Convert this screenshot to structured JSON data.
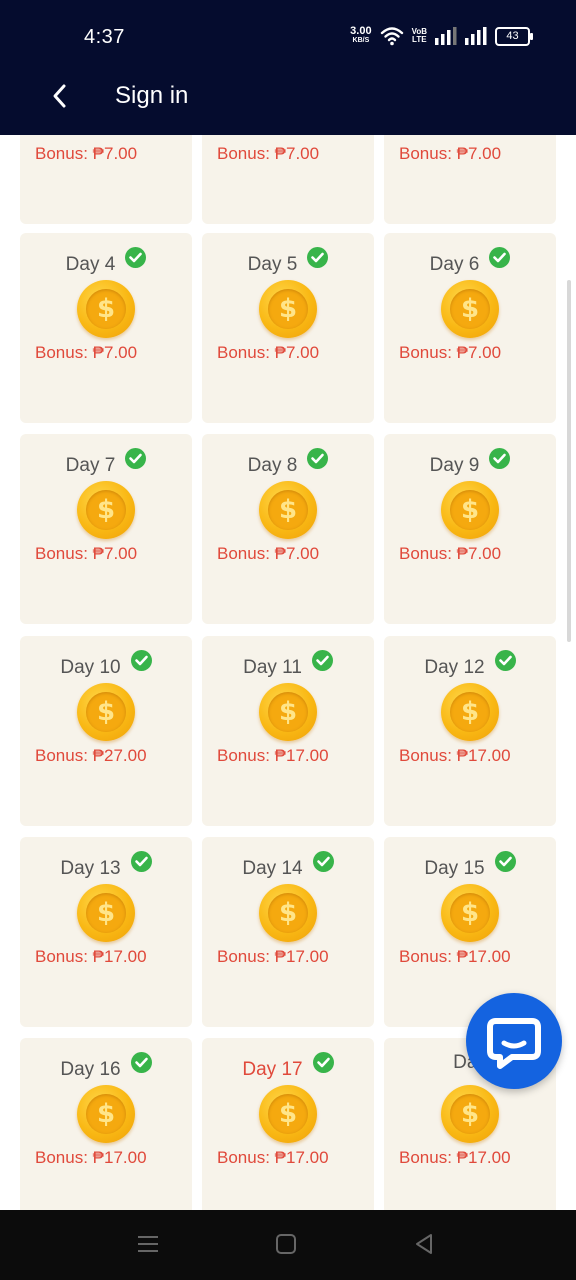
{
  "status_bar": {
    "time": "4:37",
    "network_speed": "3.00",
    "network_unit": "KB/S",
    "volte_top": "VoB",
    "volte_bottom": "LTE",
    "battery": "43"
  },
  "header": {
    "title": "Sign in",
    "back_icon": "chevron-left-icon"
  },
  "colors": {
    "header_bg": "#050c2e",
    "card_bg": "#f7f3ea",
    "bonus_text": "#e0493b",
    "check": "#38b44a",
    "coin": "#f9b814",
    "chat_fab": "#1463e0"
  },
  "partial_row": [
    {
      "bonus": "Bonus: ₱7.00"
    },
    {
      "bonus": "Bonus: ₱7.00"
    },
    {
      "bonus": "Bonus: ₱7.00"
    }
  ],
  "days": [
    {
      "label": "Day 4",
      "bonus": "Bonus: ₱7.00",
      "checked": true
    },
    {
      "label": "Day 5",
      "bonus": "Bonus: ₱7.00",
      "checked": true
    },
    {
      "label": "Day 6",
      "bonus": "Bonus: ₱7.00",
      "checked": true
    },
    {
      "label": "Day 7",
      "bonus": "Bonus: ₱7.00",
      "checked": true
    },
    {
      "label": "Day 8",
      "bonus": "Bonus: ₱7.00",
      "checked": true
    },
    {
      "label": "Day 9",
      "bonus": "Bonus: ₱7.00",
      "checked": true
    },
    {
      "label": "Day 10",
      "bonus": "Bonus: ₱27.00",
      "checked": true
    },
    {
      "label": "Day 11",
      "bonus": "Bonus: ₱17.00",
      "checked": true
    },
    {
      "label": "Day 12",
      "bonus": "Bonus: ₱17.00",
      "checked": true
    },
    {
      "label": "Day 13",
      "bonus": "Bonus: ₱17.00",
      "checked": true
    },
    {
      "label": "Day 14",
      "bonus": "Bonus: ₱17.00",
      "checked": true
    },
    {
      "label": "Day 15",
      "bonus": "Bonus: ₱17.00",
      "checked": true
    },
    {
      "label": "Day 16",
      "bonus": "Bonus: ₱17.00",
      "checked": true
    },
    {
      "label": "Day 17",
      "bonus": "Bonus: ₱17.00",
      "checked": true,
      "current": true
    },
    {
      "label": "Day",
      "bonus": "Bonus: ₱17.00",
      "checked": false
    }
  ],
  "coin_symbol": "$",
  "chat_button_icon": "chat-bubble-icon",
  "nav_bar": {
    "menu_icon": "menu-icon",
    "home_icon": "home-square-icon",
    "back_icon": "back-triangle-icon"
  }
}
